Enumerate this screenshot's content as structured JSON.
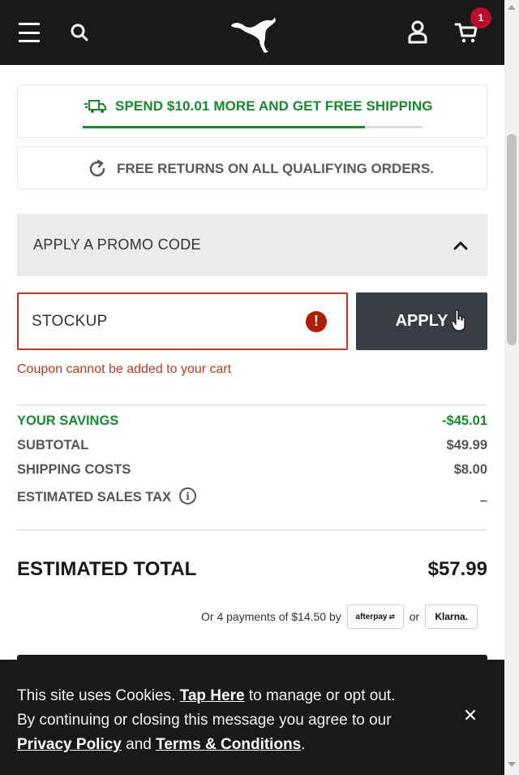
{
  "header": {
    "cart_count": "1",
    "icons": [
      "menu-icon",
      "search-icon",
      "puma-logo",
      "account-icon",
      "cart-icon"
    ]
  },
  "shipping": {
    "message": "SPEND $10.01 MORE AND GET FREE SHIPPING",
    "progress_fraction": 0.83,
    "accent_color": "#168a2e"
  },
  "returns": {
    "message": "FREE RETURNS ON ALL QUALIFYING ORDERS."
  },
  "promo": {
    "title": "APPLY A PROMO CODE",
    "code_value": "STOCKUP",
    "apply_label": "APPLY",
    "error": "Coupon cannot be added to your cart",
    "error_color": "#b83a1d"
  },
  "summary": {
    "savings_label": "YOUR SAVINGS",
    "savings_value": "-$45.01",
    "subtotal_label": "SUBTOTAL",
    "subtotal_value": "$49.99",
    "shipping_label": "SHIPPING COSTS",
    "shipping_value": "$8.00",
    "tax_label": "ESTIMATED SALES TAX",
    "tax_value": "–",
    "total_label": "ESTIMATED TOTAL",
    "total_value": "$57.99"
  },
  "installments": {
    "text": "Or 4 payments of $14.50 by",
    "afterpay": "afterpay",
    "or": "or",
    "klarna": "Klarna."
  },
  "cookie": {
    "line1_prefix": "This site uses Cookies. ",
    "tap_here": "Tap Here",
    "line1_suffix": " to manage or opt out.",
    "line2": "By continuing or closing this message you agree to our",
    "privacy": "Privacy Policy",
    "and": " and ",
    "terms": "Terms & Conditions",
    "period": "."
  }
}
